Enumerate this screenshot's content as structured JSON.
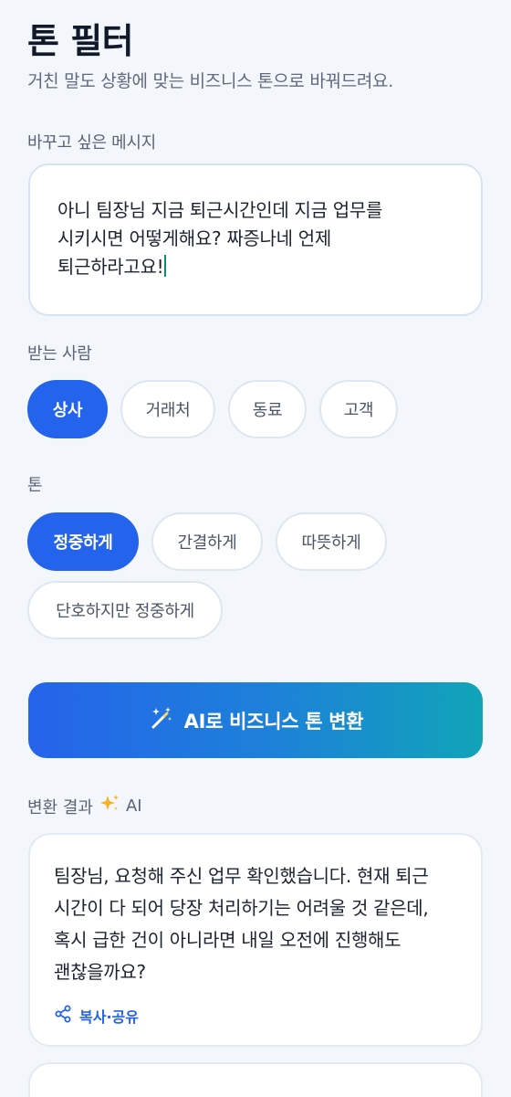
{
  "header": {
    "title": "톤 필터",
    "subtitle": "거친 말도 상황에 맞는 비즈니스 톤으로 바꿔드려요."
  },
  "message": {
    "label": "바꾸고 싶은 메시지",
    "value": "아니 팀장님 지금 퇴근시간인데 지금 업무를\n시키시면 어떻게해요? 짜증나네 언제\n퇴근하라고요!"
  },
  "recipient": {
    "label": "받는 사람",
    "options": [
      "상사",
      "거래처",
      "동료",
      "고객"
    ],
    "selected": "상사"
  },
  "tone": {
    "label": "톤",
    "options": [
      "정중하게",
      "간결하게",
      "따뜻하게",
      "단호하지만 정중하게"
    ],
    "selected": "정중하게"
  },
  "convert_button": {
    "label": "AI로 비즈니스 톤 변환",
    "icon": "magic-wand-icon"
  },
  "result": {
    "label": "변환 결과",
    "ai_badge": "AI",
    "ai_icon": "sparkles-icon",
    "cards": [
      {
        "text": "팀장님, 요청해 주신 업무 확인했습니다. 현재 퇴근\n시간이 다 되어 당장 처리하기는 어려울 것 같은데,\n혹시 급한 건이 아니라면 내일 오전에 진행해도\n괜찮을까요?",
        "share_label": "복사·공유"
      }
    ]
  },
  "colors": {
    "accent": "#2463eb",
    "background": "#f3f7fc",
    "gradient_end": "#10a4b8"
  }
}
